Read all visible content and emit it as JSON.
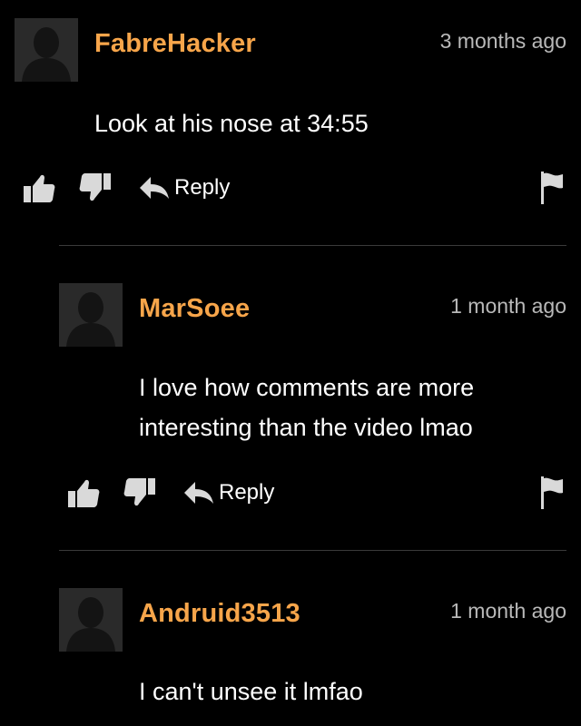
{
  "theme": {
    "background": "#000000",
    "username_color": "#f7a54a",
    "timestamp_color": "#b9b9b9",
    "text_color": "#ffffff",
    "icon_color": "#d9d9d9",
    "avatar_bg": "#2a2a2a",
    "divider_color": "#3a3a3a"
  },
  "comments": [
    {
      "username": "FabreHacker",
      "timestamp": "3 months ago",
      "text": "Look at his nose at 34:55",
      "reply_label": "Reply",
      "icons": [
        "avatar",
        "thumbs-up-icon",
        "thumbs-down-icon",
        "reply-arrow-icon",
        "flag-icon"
      ]
    },
    {
      "username": "MarSoee",
      "timestamp": "1 month ago",
      "text_lines": [
        "I love how comments are more",
        "interesting than the video lmao"
      ],
      "reply_label": "Reply",
      "icons": [
        "avatar",
        "thumbs-up-icon",
        "thumbs-down-icon",
        "reply-arrow-icon",
        "flag-icon"
      ]
    },
    {
      "username": "Andruid3513",
      "timestamp": "1 month ago",
      "text": "I can't unsee it lmfao",
      "icons": [
        "avatar"
      ]
    }
  ]
}
